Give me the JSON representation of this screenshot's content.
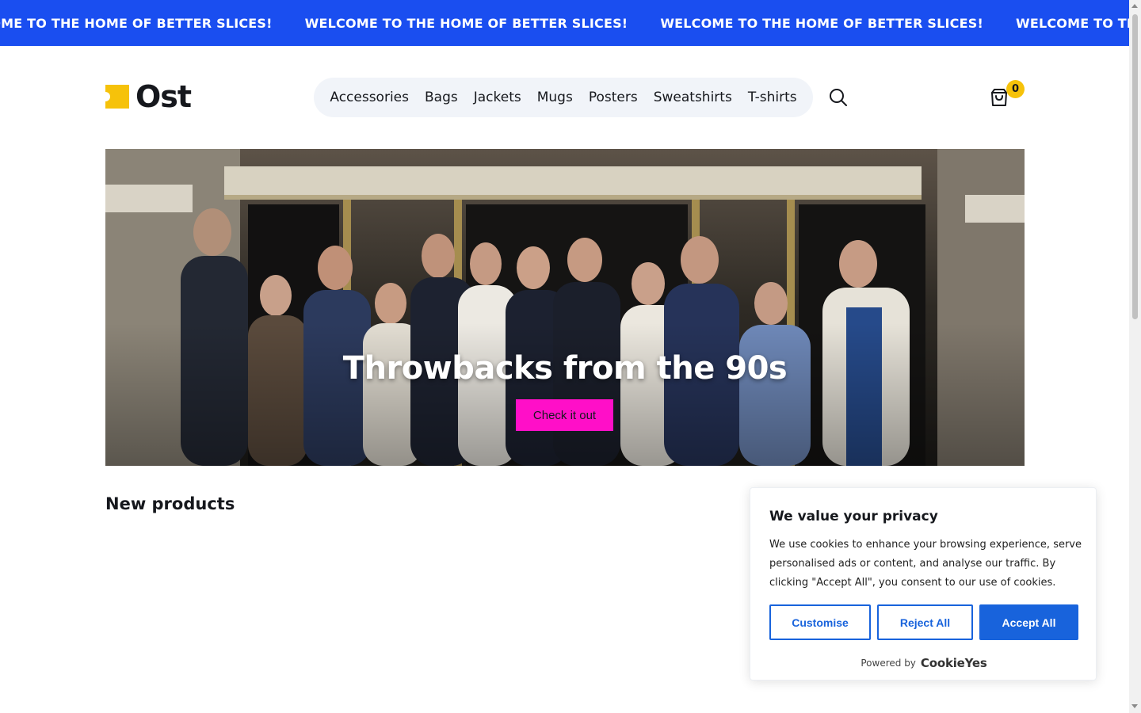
{
  "announcement": {
    "messages": [
      "WELCOME TO THE HOME OF BETTER SLICES!",
      "WELCOME TO THE HOME OF BETTER SLICES!",
      "WELCOME TO THE HOME OF BETTER SLICES!",
      "WELCOME TO THE HOME OF BETTER SLICES!"
    ]
  },
  "header": {
    "logo_text": "Ost",
    "nav": [
      "Accessories",
      "Bags",
      "Jackets",
      "Mugs",
      "Posters",
      "Sweatshirts",
      "T-shirts"
    ],
    "search_icon": "search-icon",
    "cart_icon": "shopping-bag-icon",
    "cart_count": "0"
  },
  "hero": {
    "title": "Throwbacks from the 90s",
    "cta_label": "Check it out",
    "cta_color": "#ff0fc8"
  },
  "main": {
    "section_title": "New products"
  },
  "cookie_banner": {
    "title": "We value your privacy",
    "text": "We use cookies to enhance your browsing experience, serve personalised ads or content, and analyse our traffic. By clicking \"Accept All\", you consent to our use of cookies.",
    "buttons": {
      "customise": "Customise",
      "reject": "Reject All",
      "accept": "Accept All"
    },
    "powered_by": "Powered by",
    "brand": "CookieYes"
  },
  "colors": {
    "announcement_bg": "#1a4ef0",
    "accent_yellow": "#f6c20a",
    "cookie_blue": "#1863dc"
  }
}
